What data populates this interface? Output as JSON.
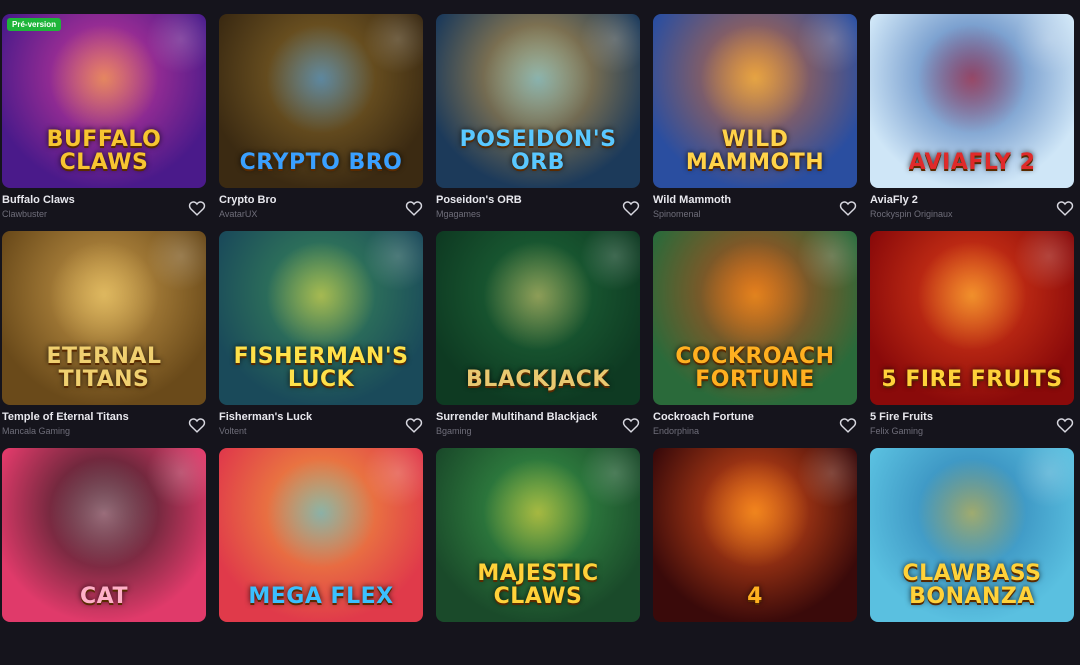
{
  "games": [
    {
      "name": "Buffalo Claws",
      "provider": "Clawbuster",
      "badge": "Pré-version",
      "art_title": "Buffalo Claws",
      "bg": [
        "#4a1a8a",
        "#d03a9a"
      ],
      "accent": "#f7c531",
      "art_icon": "buffalo-icon"
    },
    {
      "name": "Crypto Bro",
      "provider": "AvatarUX",
      "badge": "",
      "art_title": "Crypto Bro",
      "bg": [
        "#3b2a12",
        "#8a6a2a"
      ],
      "accent": "#3aa0ff",
      "art_icon": "coin-icon"
    },
    {
      "name": "Poseidon's ORB",
      "provider": "Mgagames",
      "badge": "",
      "art_title": "Poseidon's Orb",
      "bg": [
        "#1c3a5a",
        "#c79a4a"
      ],
      "accent": "#5ac8ff",
      "art_icon": "orb-icon"
    },
    {
      "name": "Wild Mammoth",
      "provider": "Spinomenal",
      "badge": "",
      "art_title": "Wild Mammoth",
      "bg": [
        "#2a4ea0",
        "#c86a3a"
      ],
      "accent": "#ffd34a",
      "art_icon": "mammoth-icon"
    },
    {
      "name": "AviaFly 2",
      "provider": "Rockyspin Originaux",
      "badge": "",
      "art_title": "Aviafly 2",
      "bg": [
        "#cfe6f7",
        "#3a6ab0"
      ],
      "accent": "#e02a2a",
      "art_icon": "plane-icon"
    },
    {
      "name": "Temple of Eternal Titans",
      "provider": "Mancala Gaming",
      "badge": "",
      "art_title": "Eternal Titans",
      "bg": [
        "#6a4a1a",
        "#c89a4a"
      ],
      "accent": "#f0d070",
      "art_icon": "temple-icon"
    },
    {
      "name": "Fisherman's Luck",
      "provider": "Voltent",
      "badge": "",
      "art_title": "Fisherman's Luck",
      "bg": [
        "#1a4a5a",
        "#3a8a5a"
      ],
      "accent": "#ffe14a",
      "art_icon": "fish-icon"
    },
    {
      "name": "Surrender Multihand Blackjack",
      "provider": "Bgaming",
      "badge": "",
      "art_title": "Blackjack",
      "bg": [
        "#0e3a22",
        "#1f6a3a"
      ],
      "accent": "#e8c870",
      "art_icon": "cards-icon"
    },
    {
      "name": "Cockroach Fortune",
      "provider": "Endorphina",
      "badge": "",
      "art_title": "Cockroach Fortune",
      "bg": [
        "#2a6a3a",
        "#c04a1a"
      ],
      "accent": "#ffb020",
      "art_icon": "cockroach-icon"
    },
    {
      "name": "5 Fire Fruits",
      "provider": "Felix Gaming",
      "badge": "",
      "art_title": "5 Fire Fruits",
      "bg": [
        "#8a0a0a",
        "#e0401a"
      ],
      "accent": "#ffd23a",
      "art_icon": "fruits-icon"
    },
    {
      "name": "",
      "provider": "",
      "badge": "",
      "art_title": "Cat",
      "bg": [
        "#e03a6a",
        "#1a1a1a"
      ],
      "accent": "#ffb0c8",
      "art_icon": "cat-icon"
    },
    {
      "name": "",
      "provider": "",
      "badge": "",
      "art_title": "Mega Flex",
      "bg": [
        "#e03a4a",
        "#f0a03a"
      ],
      "accent": "#3ac0ff",
      "art_icon": "flex-icon"
    },
    {
      "name": "",
      "provider": "",
      "badge": "",
      "art_title": "Majestic Claws",
      "bg": [
        "#1a4a2a",
        "#3a9a4a"
      ],
      "accent": "#ffd23a",
      "art_icon": "tiger-icon"
    },
    {
      "name": "",
      "provider": "",
      "badge": "",
      "art_title": "4",
      "bg": [
        "#3a0a0a",
        "#e0501a"
      ],
      "accent": "#ffb020",
      "art_icon": "seven-icon"
    },
    {
      "name": "",
      "provider": "",
      "badge": "",
      "art_title": "ClawBass Bonanza",
      "bg": [
        "#5ac0e0",
        "#2a7ab0"
      ],
      "accent": "#ffd23a",
      "art_icon": "fisher-icon"
    }
  ]
}
